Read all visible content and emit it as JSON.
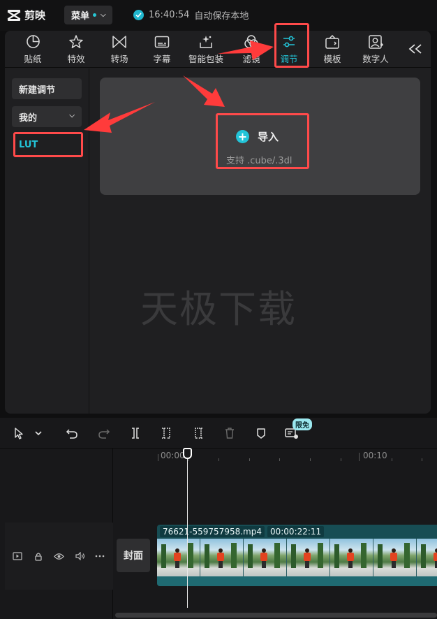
{
  "app": {
    "name": "剪映",
    "menu_label": "菜单",
    "save_time": "16:40:54",
    "save_text": "自动保存本地"
  },
  "toolbar": {
    "items": [
      {
        "label": "贴纸",
        "icon": "sticker-icon"
      },
      {
        "label": "特效",
        "icon": "effects-icon"
      },
      {
        "label": "转场",
        "icon": "transition-icon"
      },
      {
        "label": "字幕",
        "icon": "subtitle-icon"
      },
      {
        "label": "智能包装",
        "icon": "smart-pack-icon"
      },
      {
        "label": "滤镜",
        "icon": "filter-icon"
      },
      {
        "label": "调节",
        "icon": "adjust-icon",
        "active": true
      },
      {
        "label": "模板",
        "icon": "template-icon"
      },
      {
        "label": "数字人",
        "icon": "digital-human-icon"
      }
    ],
    "collapse_icon": "double-chevron-left-icon"
  },
  "sidebar": {
    "new_adjust": "新建调节",
    "mine": "我的",
    "lut": "LUT"
  },
  "import": {
    "label": "导入",
    "support": "支持 .cube/.3dl"
  },
  "watermark": "天极下载",
  "timeline": {
    "free_badge": "限免",
    "ruler": {
      "t0": "00:00",
      "t1": "00:10"
    },
    "cover_label": "封面",
    "clip": {
      "filename": "76621-559757958.mp4",
      "duration": "00:00:22:11"
    }
  },
  "colors": {
    "accent": "#23c4d8",
    "highlight": "#ff4a4a",
    "panel_bg": "#1f1f21"
  }
}
